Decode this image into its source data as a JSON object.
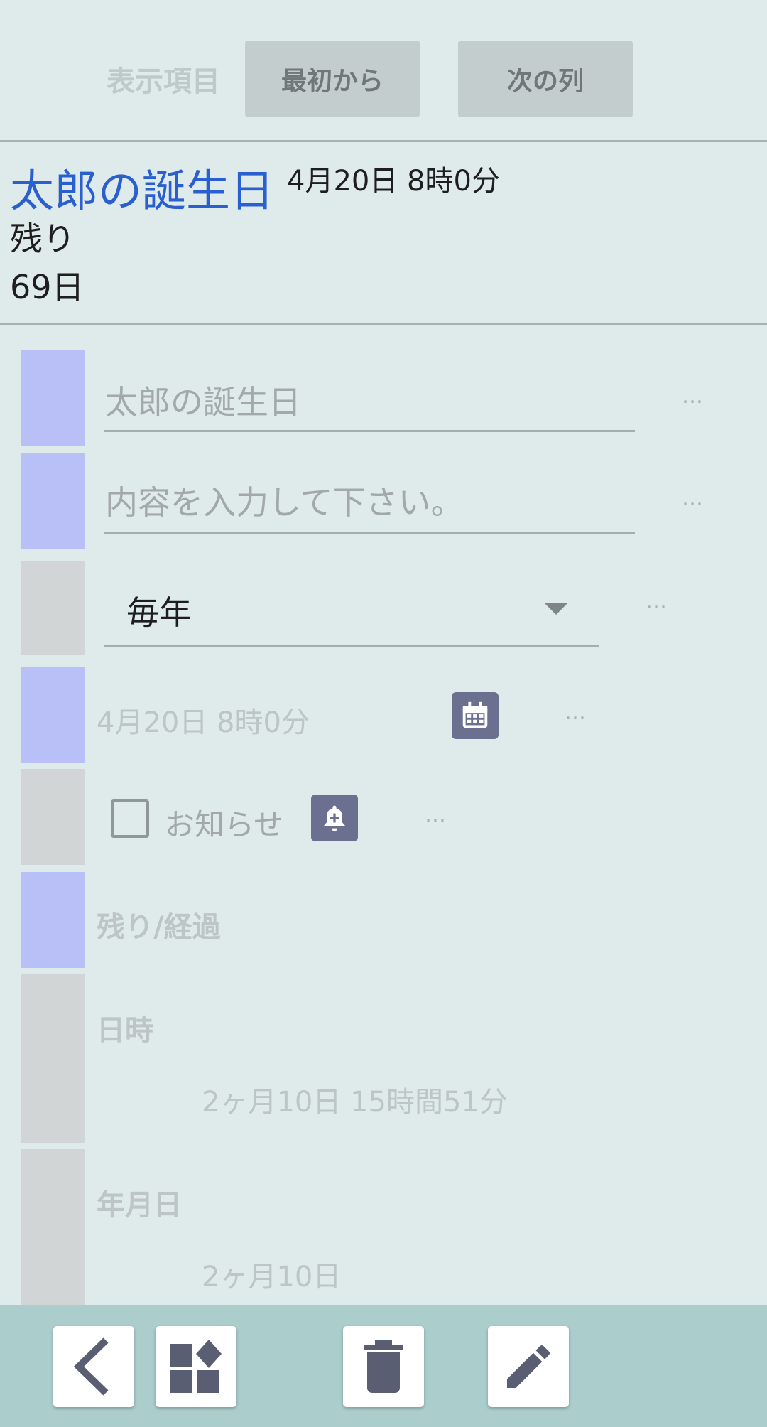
{
  "toolbar": {
    "display_items_label": "表示項目",
    "from_start_label": "最初から",
    "next_column_label": "次の列"
  },
  "summary": {
    "title": "太郎の誕生日",
    "datetime": "4月20日 8時0分",
    "remaining_label": "残り",
    "remaining_value": "69日"
  },
  "form": {
    "title_value": "太郎の誕生日",
    "content_placeholder": "内容を入力して下さい。",
    "repeat_value": "毎年",
    "date_value": "4月20日 8時0分",
    "notify_label": "お知らせ",
    "notify_checked": false,
    "more_label": "…"
  },
  "sections": {
    "remaining_elapsed_label": "残り/経過",
    "datetime_label": "日時",
    "datetime_value": "2ヶ月10日 15時間51分",
    "ymd_label": "年月日",
    "ymd_value": "2ヶ月10日"
  },
  "colors": {
    "background": "#deebea",
    "accent_blue": "#2a5fd0",
    "swatch_blue": "#b9bff7",
    "swatch_gray": "#d1d5d5",
    "bottom_bar": "#abcdcc",
    "icon_fill": "#5a5e72"
  },
  "icons": {
    "calendar": "calendar-icon",
    "notification_add": "bell-plus-icon",
    "back": "chevron-left-icon",
    "widgets": "widgets-icon",
    "delete": "trash-icon",
    "edit": "pencil-icon"
  }
}
